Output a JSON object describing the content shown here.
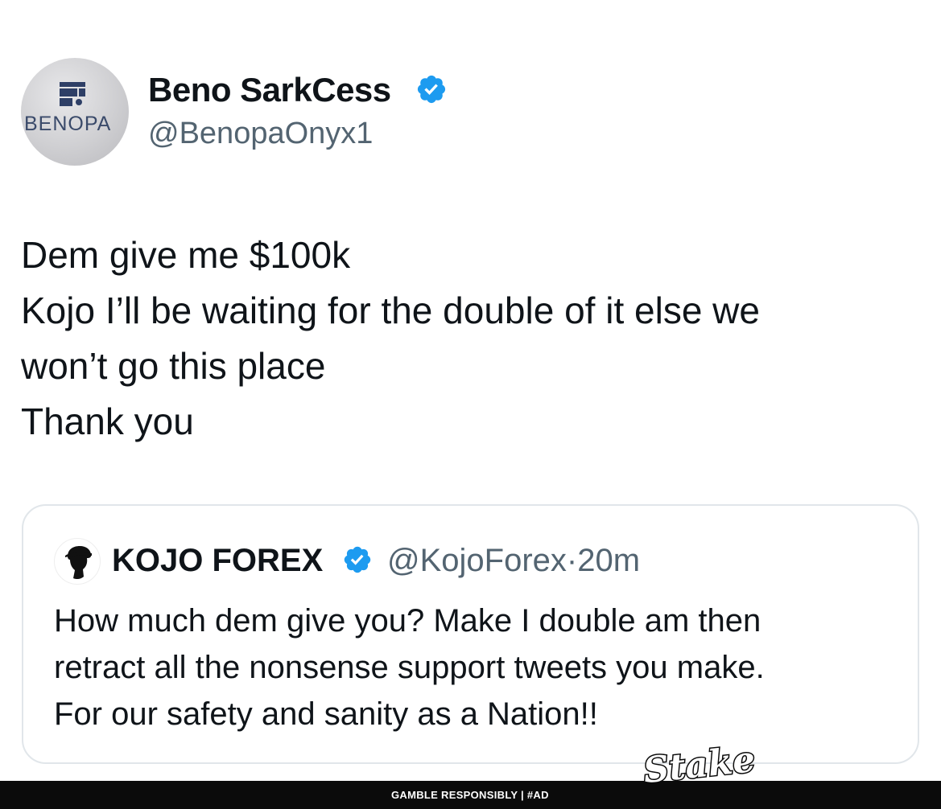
{
  "author": {
    "display_name": "Beno SarkCess",
    "handle": "@BenopaOnyx1",
    "avatar_brand": "BENOPA",
    "verified_icon": "verified-badge-icon"
  },
  "tweet": {
    "lines": [
      "Dem give me $100k",
      "Kojo I’ll be waiting for the double of it else we",
      "won’t go this place",
      "Thank you"
    ]
  },
  "quoted_tweet": {
    "display_name": "KOJO FOREX",
    "handle": "@KojoForex",
    "separator": "·",
    "time": "20m",
    "lines": [
      "How much dem give you? Make I double am then",
      "retract all the nonsense support tweets you make.",
      "For our safety and sanity as a Nation!!"
    ]
  },
  "ad_bar": {
    "text": "GAMBLE RESPONSIBLY  |  #AD",
    "logo_text": "Stake"
  },
  "colors": {
    "verified": "#1d9bf0",
    "text": "#0f1419",
    "secondary_text": "#536471",
    "border": "#e1e6ea",
    "ad_bar": "#0b0b0b"
  }
}
